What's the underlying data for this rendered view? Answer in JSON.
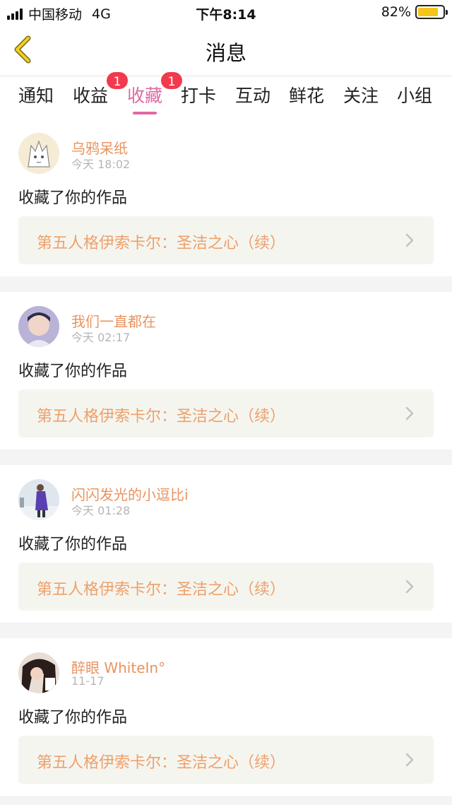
{
  "status_bar": {
    "carrier": "中国移动",
    "network": "4G",
    "time": "下午8:14",
    "battery": "82%",
    "battery_level": 0.82,
    "battery_color": "#f5c518"
  },
  "header": {
    "title": "消息",
    "back_icon": "chevron-left-icon"
  },
  "colors": {
    "accent": "#e06aa5",
    "username": "#e8935f",
    "work_title": "#eda06b",
    "badge": "#f23a4e"
  },
  "tabs": [
    {
      "label": "通知"
    },
    {
      "label": "收益",
      "badge": "1"
    },
    {
      "label": "收藏",
      "badge": "1",
      "active": true
    },
    {
      "label": "打卡"
    },
    {
      "label": "互动"
    },
    {
      "label": "鲜花"
    },
    {
      "label": "关注"
    },
    {
      "label": "小组"
    }
  ],
  "messages": [
    {
      "username": "乌鸦呆纸",
      "time": "今天 18:02",
      "action": "收藏了你的作品",
      "work_title": "第五人格伊索卡尔：圣洁之心（续）",
      "avatar_icon": "anime-character-avatar"
    },
    {
      "username": "我们一直都在",
      "time": "今天 02:17",
      "action": "收藏了你的作品",
      "work_title": "第五人格伊索卡尔：圣洁之心（续）",
      "avatar_icon": "person-portrait-avatar"
    },
    {
      "username": "闪闪发光的小逗比i",
      "time": "今天 01:28",
      "action": "收藏了你的作品",
      "work_title": "第五人格伊索卡尔：圣洁之心（续）",
      "avatar_icon": "person-outdoor-avatar"
    },
    {
      "username": "醉眼 WhiteIn°",
      "time": "11-17",
      "action": "收藏了你的作品",
      "work_title": "第五人格伊索卡尔：圣洁之心（续）",
      "avatar_icon": "person-dark-hair-avatar"
    }
  ]
}
